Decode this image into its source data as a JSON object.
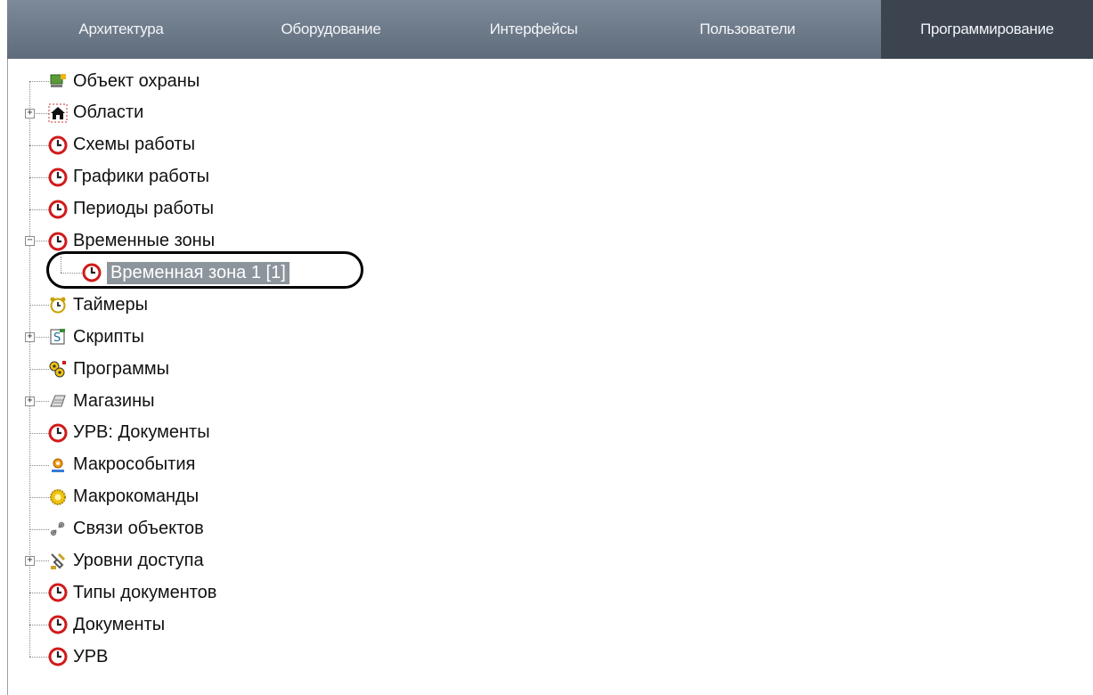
{
  "tabs": [
    "Архитектура",
    "Оборудование",
    "Интерфейсы",
    "Пользователи",
    "Программирование"
  ],
  "active_tab": "Программирование",
  "tree": {
    "items": [
      {
        "label": "Объект охраны",
        "icon": "monitor-icon"
      },
      {
        "label": "Области",
        "icon": "house-icon",
        "expander": "+"
      },
      {
        "label": "Схемы работы",
        "icon": "clock-icon"
      },
      {
        "label": "Графики работы",
        "icon": "clock-icon"
      },
      {
        "label": "Периоды работы",
        "icon": "clock-icon"
      },
      {
        "label": "Временные зоны",
        "icon": "clock-icon",
        "expander": "−"
      },
      {
        "label": "Временная зона 1 [1]",
        "icon": "clock-icon",
        "selected": true
      },
      {
        "label": "Таймеры",
        "icon": "alarm-clock-icon"
      },
      {
        "label": "Скрипты",
        "icon": "script-icon",
        "expander": "+"
      },
      {
        "label": "Программы",
        "icon": "gears-icon"
      },
      {
        "label": "Магазины",
        "icon": "cash-register-icon",
        "expander": "+"
      },
      {
        "label": "УРВ: Документы",
        "icon": "clock-icon"
      },
      {
        "label": "Макрособытия",
        "icon": "macro-event-icon"
      },
      {
        "label": "Макрокоманды",
        "icon": "macro-command-icon"
      },
      {
        "label": "Связи объектов",
        "icon": "link-icon"
      },
      {
        "label": "Уровни доступа",
        "icon": "keys-icon",
        "expander": "+"
      },
      {
        "label": "Типы документов",
        "icon": "clock-icon"
      },
      {
        "label": "Документы",
        "icon": "clock-icon"
      },
      {
        "label": "УРВ",
        "icon": "clock-icon"
      }
    ]
  },
  "colors": {
    "tabbar": "#6e7b8a",
    "active_tab": "#3b444f",
    "clock_red": "#d11a1a",
    "selection": "#8c949c"
  }
}
